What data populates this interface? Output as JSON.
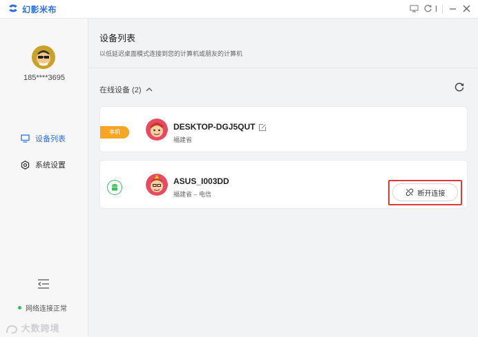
{
  "app": {
    "brand": "幻影米布"
  },
  "user": {
    "phone": "185****3695"
  },
  "sidebar": {
    "items": [
      {
        "label": "设备列表",
        "icon": "monitor-icon",
        "active": true
      },
      {
        "label": "系统设置",
        "icon": "gear-icon",
        "active": false
      }
    ],
    "network_status": "网络连接正常"
  },
  "page": {
    "title": "设备列表",
    "subtitle": "以低延迟桌面模式连接到您的计算机或朋友的计算机"
  },
  "online": {
    "label": "在线设备 (2)"
  },
  "devices": [
    {
      "name": "DESKTOP-DGJ5QUT",
      "location": "福建省",
      "badge": "本机",
      "icon": "windows-pc"
    },
    {
      "name": "ASUS_I003DD",
      "location": "福建省 – 电信",
      "icon": "android-icon",
      "action": "断开连接"
    }
  ],
  "watermark": "大数跨境",
  "colors": {
    "accent": "#2f6fe0",
    "badge": "#f5a623",
    "highlight": "#e53935",
    "online": "#2fbf59"
  }
}
